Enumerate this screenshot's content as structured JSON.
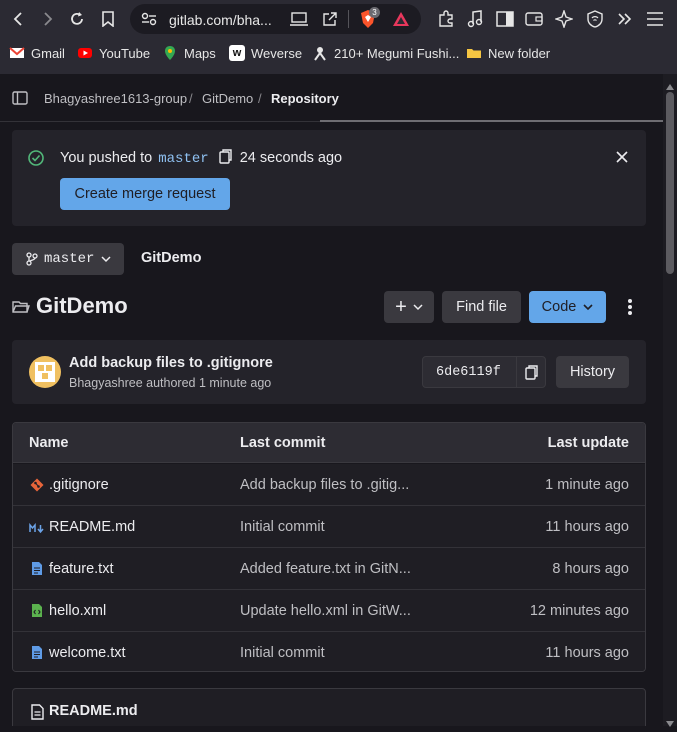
{
  "browser": {
    "url": "gitlab.com/bha...",
    "brave_badge": "3",
    "bookmarks": [
      "Gmail",
      "YouTube",
      "Maps",
      "Weverse",
      "210+ Megumi Fushi...",
      "New folder"
    ]
  },
  "breadcrumb": {
    "group": "Bhagyashree1613-group",
    "project": "GitDemo",
    "current": "Repository",
    "sep": "/"
  },
  "alert": {
    "prefix": "You pushed to",
    "branch": "master",
    "time": "24 seconds ago",
    "button": "Create merge request"
  },
  "branch_bar": {
    "branch": "master",
    "project": "GitDemo"
  },
  "repo": {
    "title": "GitDemo",
    "add": "+",
    "find_file": "Find file",
    "code": "Code"
  },
  "last_commit": {
    "message": "Add backup files to .gitignore",
    "author": "Bhagyashree authored 1 minute ago",
    "sha": "6de6119f",
    "history": "History"
  },
  "files_table": {
    "headers": {
      "name": "Name",
      "last_commit": "Last commit",
      "last_update": "Last update"
    },
    "rows": [
      {
        "name": ".gitignore",
        "commit": "Add backup files to .gitig...",
        "updated": "1 minute ago",
        "icon": "git-icon"
      },
      {
        "name": "README.md",
        "commit": "Initial commit",
        "updated": "11 hours ago",
        "icon": "markdown-icon"
      },
      {
        "name": "feature.txt",
        "commit": "Added feature.txt in GitN...",
        "updated": "8 hours ago",
        "icon": "file-icon"
      },
      {
        "name": "hello.xml",
        "commit": "Update hello.xml in GitW...",
        "updated": "12 minutes ago",
        "icon": "xml-file-icon"
      },
      {
        "name": "welcome.txt",
        "commit": "Initial commit",
        "updated": "11 hours ago",
        "icon": "file-icon"
      }
    ]
  },
  "readme": {
    "title": "README.md"
  },
  "colors": {
    "accent": "#63a6e9",
    "success": "#52b87a",
    "bg": "#18171d"
  }
}
